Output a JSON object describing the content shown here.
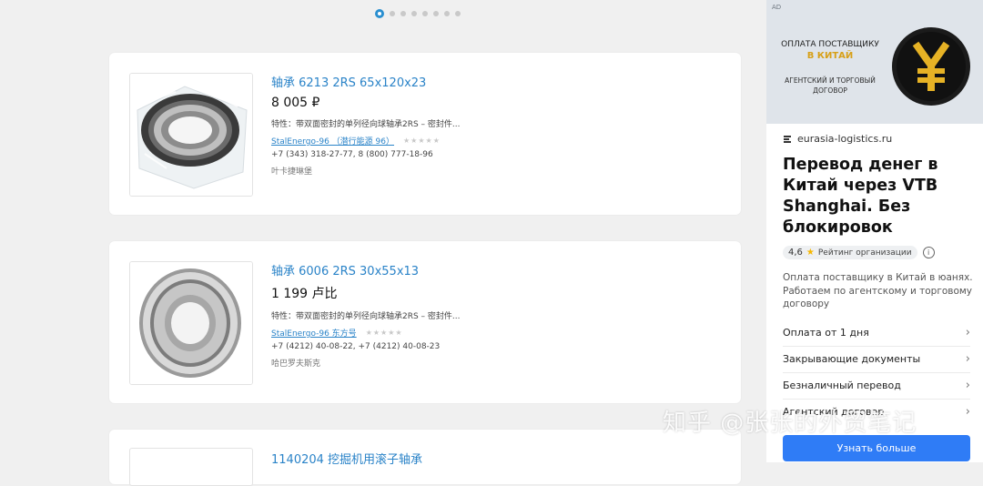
{
  "carousel": {
    "dot_count": 8,
    "active_index": 0
  },
  "products": [
    {
      "title": "轴承 6213 2RS 65x120x23",
      "price": "8 005 ₽",
      "description": "特性：带双面密封的单列径向球轴承2RS – 密封件...",
      "seller": "StalEnergo-96 （潜行能源 96）",
      "phones": "+7 (343) 318-27-77,  8 (800) 777-18-96",
      "city": "叶卡捷琳堡"
    },
    {
      "title": "轴承 6006 2RS 30x55x13",
      "price": "1 199 卢比",
      "description": "特性：带双面密封的单列径向球轴承2RS – 密封件...",
      "seller": "StalEnergo-96 东方号",
      "phones": "+7 (4212) 40-08-22,  +7 (4212) 40-08-23",
      "city": "哈巴罗夫斯克"
    },
    {
      "title": "1140204 挖掘机用滚子轴承"
    }
  ],
  "stars_text": "★★★★★",
  "ad": {
    "label": "AD",
    "banner": {
      "line1": "ОПЛАТА ПОСТАВЩИКУ",
      "line2": "В КИТАЙ",
      "line3": "АГЕНТСКИЙ И ТОРГОВЫЙ ДОГОВОР"
    },
    "domain": "eurasia-logistics.ru",
    "headline": "Перевод денег в Китай через VTB Shanghai. Без блокировок",
    "rating_value": "4,6",
    "rating_label": "Рейтинг организации",
    "description": "Оплата поставщику в Китай в юанях. Работаем по агентскому и торговому договору",
    "links": [
      "Оплата от 1 дня",
      "Закрывающие документы",
      "Безналичный перевод",
      "Агентский договор"
    ],
    "cta": "Узнать больше"
  },
  "watermark": "知乎 @张张的外贸笔记",
  "colors": {
    "link": "#2a83c8",
    "cta": "#2f7cf6",
    "star": "#f6b700",
    "gold": "#d7a018"
  }
}
